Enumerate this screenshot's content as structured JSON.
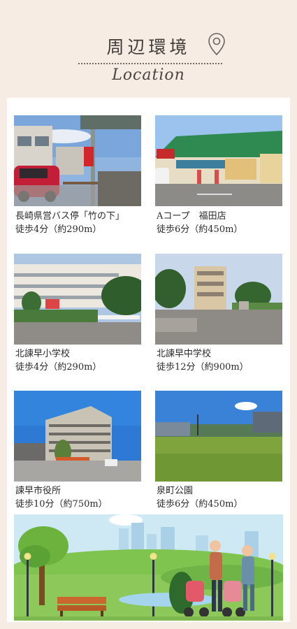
{
  "header": {
    "title": "周辺環境",
    "subtitle": "Location"
  },
  "places": [
    {
      "name": "長崎県営バス停「竹の下」",
      "walk": "徒歩4分（約290m）"
    },
    {
      "name": "Aコープ　福田店",
      "walk": "徒歩6分（約450m）"
    },
    {
      "name": "北諫早小学校",
      "walk": "徒歩4分（約290m）"
    },
    {
      "name": "北諫早中学校",
      "walk": "徒歩12分（約900m）"
    },
    {
      "name": "諫早市役所",
      "walk": "徒歩10分（約750m）"
    },
    {
      "name": "泉町公園",
      "walk": "徒歩6分（約450m）"
    }
  ],
  "colors": {
    "page_background": "#f6ece4",
    "card_background": "#ffffff",
    "title_text": "#3f3a36"
  },
  "icons": {
    "title_icon": "location-pin-icon"
  }
}
